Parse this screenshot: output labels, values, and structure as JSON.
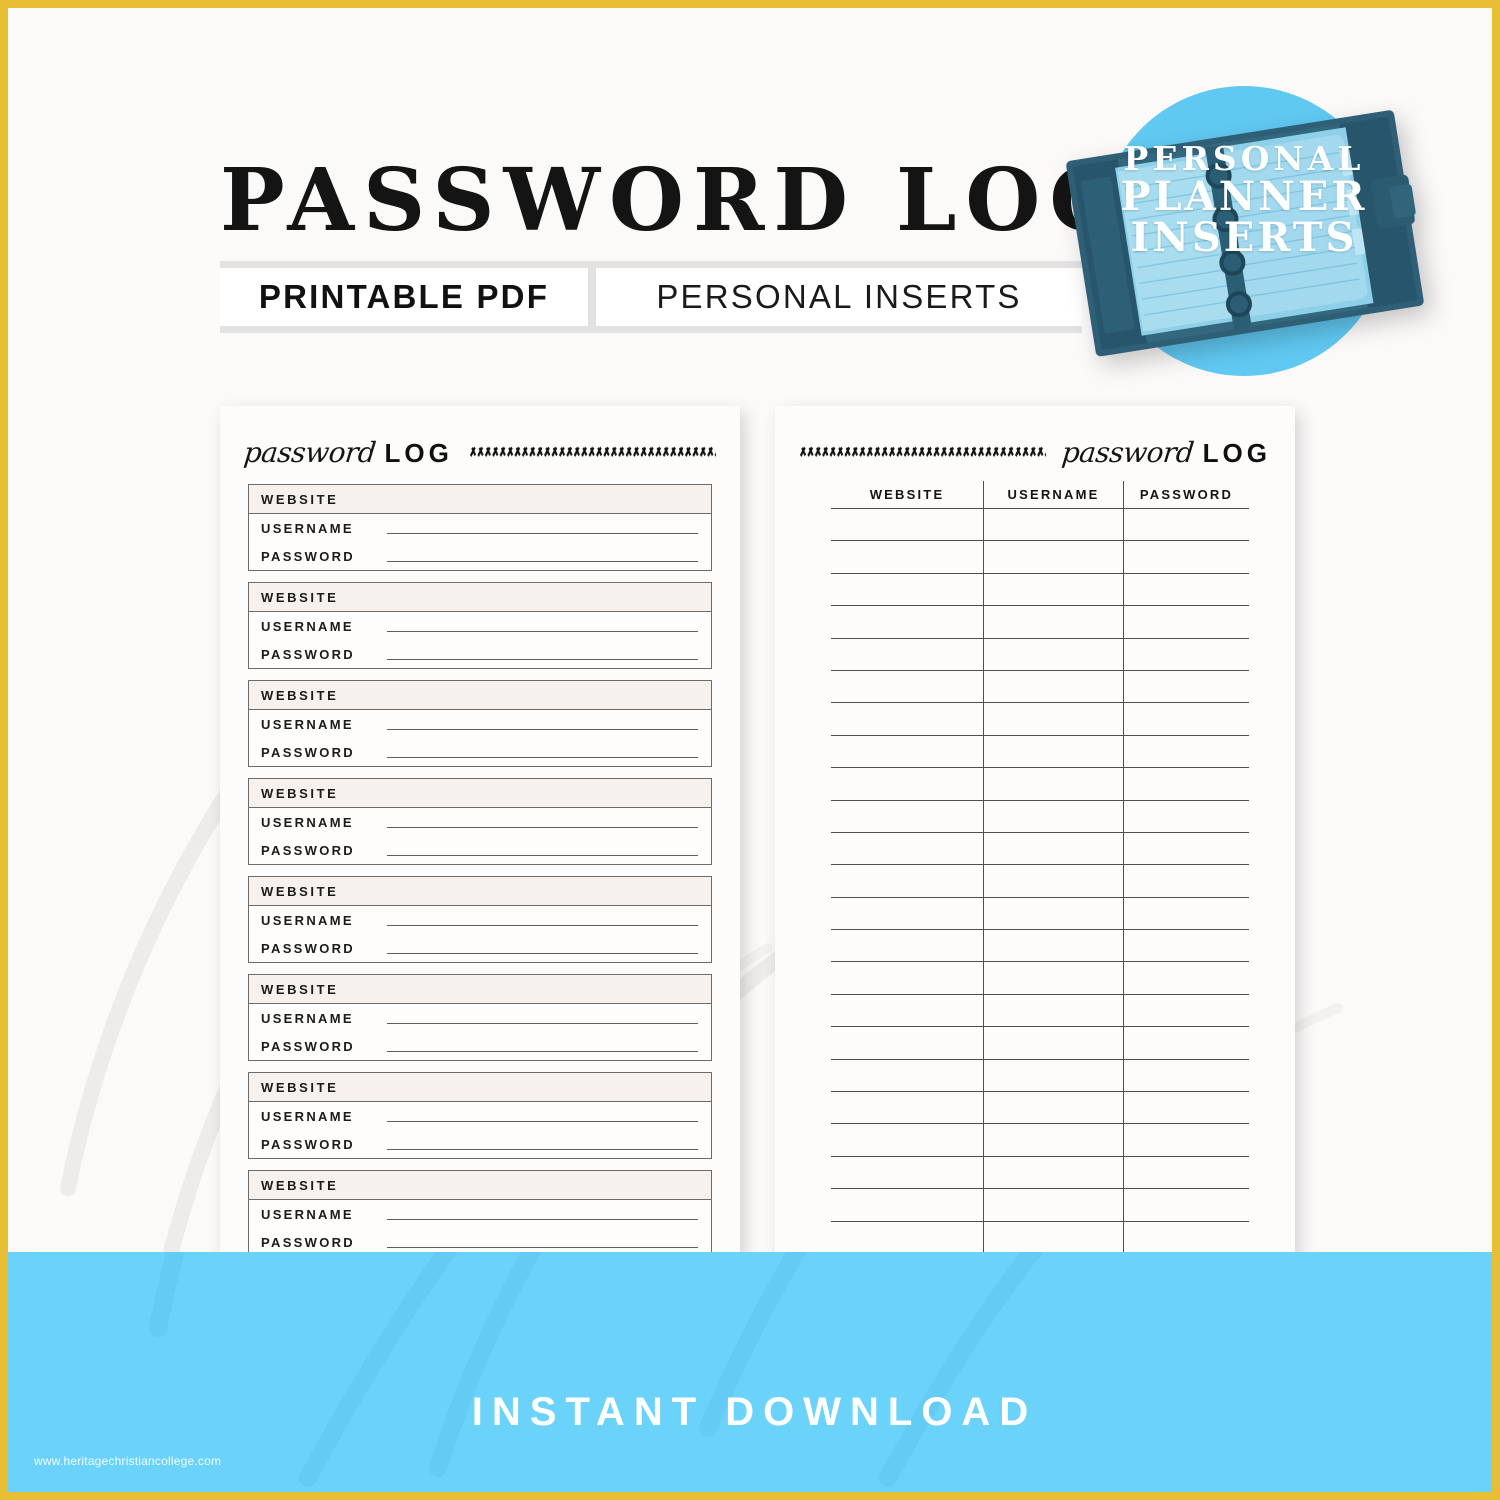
{
  "frame": {
    "border_color": "#E8BE35",
    "background": "#FCFAF9"
  },
  "masthead": {
    "title": "PASSWORD LOG",
    "tag_pdf": "PRINTABLE PDF",
    "tag_inserts": "PERSONAL INSERTS"
  },
  "badge": {
    "line1": "PERSONAL",
    "line2": "PLANNER",
    "line3": "INSERTS",
    "circle_color": "#60C9F2",
    "text_color": "#FDFEFE"
  },
  "footer": {
    "cta": "INSTANT DOWNLOAD",
    "url": "www.heritagechristiancollege.com",
    "band_color": "#6BD2FA",
    "text_color": "#FFFFFF"
  },
  "page_left": {
    "header_script": "password",
    "header_log": "LOG",
    "labels": {
      "website": "WEBSITE",
      "username": "USERNAME",
      "password": "PASSWORD"
    },
    "entry_count": 8,
    "entries": [
      {
        "website": "",
        "username": "",
        "password": ""
      },
      {
        "website": "",
        "username": "",
        "password": ""
      },
      {
        "website": "",
        "username": "",
        "password": ""
      },
      {
        "website": "",
        "username": "",
        "password": ""
      },
      {
        "website": "",
        "username": "",
        "password": ""
      },
      {
        "website": "",
        "username": "",
        "password": ""
      },
      {
        "website": "",
        "username": "",
        "password": ""
      },
      {
        "website": "",
        "username": "",
        "password": ""
      }
    ]
  },
  "page_right": {
    "header_script": "password",
    "header_log": "LOG",
    "columns": [
      "WEBSITE",
      "USERNAME",
      "PASSWORD"
    ],
    "row_count": 25,
    "rows": [
      [
        "",
        "",
        ""
      ],
      [
        "",
        "",
        ""
      ],
      [
        "",
        "",
        ""
      ],
      [
        "",
        "",
        ""
      ],
      [
        "",
        "",
        ""
      ],
      [
        "",
        "",
        ""
      ],
      [
        "",
        "",
        ""
      ],
      [
        "",
        "",
        ""
      ],
      [
        "",
        "",
        ""
      ],
      [
        "",
        "",
        ""
      ],
      [
        "",
        "",
        ""
      ],
      [
        "",
        "",
        ""
      ],
      [
        "",
        "",
        ""
      ],
      [
        "",
        "",
        ""
      ],
      [
        "",
        "",
        ""
      ],
      [
        "",
        "",
        ""
      ],
      [
        "",
        "",
        ""
      ],
      [
        "",
        "",
        ""
      ],
      [
        "",
        "",
        ""
      ],
      [
        "",
        "",
        ""
      ],
      [
        "",
        "",
        ""
      ],
      [
        "",
        "",
        ""
      ],
      [
        "",
        "",
        ""
      ],
      [
        "",
        "",
        ""
      ],
      [
        "",
        "",
        ""
      ]
    ]
  }
}
